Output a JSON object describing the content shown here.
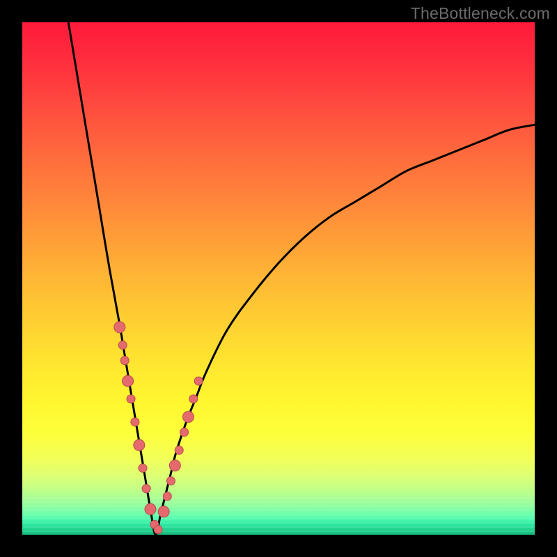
{
  "watermark": {
    "text": "TheBottleneck.com"
  },
  "colors": {
    "frame": "#000000",
    "curve_stroke": "#000000",
    "marker_fill": "#e46a6d",
    "marker_stroke": "#b84a4e"
  },
  "chart_data": {
    "type": "line",
    "title": "",
    "xlabel": "",
    "ylabel": "",
    "xlim": [
      0,
      100
    ],
    "ylim": [
      0,
      100
    ],
    "grid": false,
    "legend": false,
    "curve_model": {
      "description": "V-shaped bottleneck curve; y is percent bottleneck, valley near x≈26 at y≈0",
      "x_valley": 26,
      "left_branch_top_x": 9,
      "left_branch_top_y": 100,
      "right_branch_top_x": 100,
      "right_branch_top_y": 80
    },
    "series": [
      {
        "name": "bottleneck-curve",
        "x": [
          9,
          11,
          13,
          15,
          17,
          19,
          20,
          21,
          22,
          23,
          24,
          25,
          26,
          27,
          28,
          29,
          30,
          32,
          34,
          36,
          40,
          45,
          50,
          55,
          60,
          65,
          70,
          75,
          80,
          85,
          90,
          95,
          100
        ],
        "y": [
          100,
          88,
          76,
          64,
          52,
          41,
          35,
          29,
          23,
          17,
          11,
          5,
          0,
          4,
          8,
          12,
          16,
          22,
          27,
          32,
          40,
          47,
          53,
          58,
          62,
          65,
          68,
          71,
          73,
          75,
          77,
          79,
          80
        ]
      }
    ],
    "markers": {
      "name": "sample-points",
      "x": [
        19.0,
        19.6,
        20.0,
        20.6,
        21.2,
        22.0,
        22.8,
        23.5,
        24.2,
        25.0,
        25.8,
        26.5,
        27.6,
        28.3,
        29.0,
        29.8,
        30.6,
        31.6,
        32.4,
        33.4,
        34.4
      ],
      "y": [
        40.5,
        37.0,
        34.0,
        30.0,
        26.5,
        22.0,
        17.5,
        13.0,
        9.0,
        5.0,
        2.0,
        1.0,
        4.5,
        7.5,
        10.5,
        13.5,
        16.5,
        20.0,
        23.0,
        26.5,
        30.0
      ]
    }
  }
}
